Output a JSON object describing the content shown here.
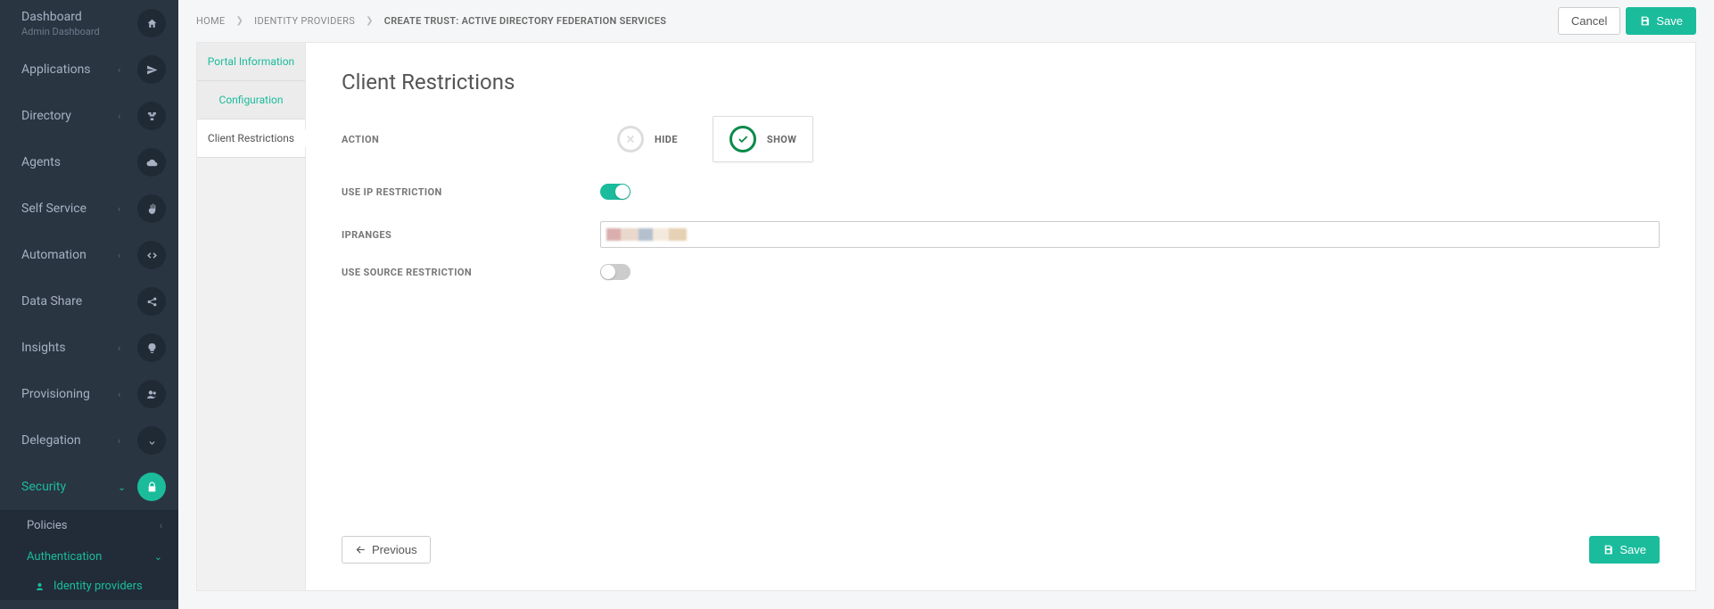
{
  "sidebar": {
    "items": [
      {
        "label": "Dashboard",
        "sub": "Admin Dashboard",
        "icon": "home",
        "chev": ""
      },
      {
        "label": "Applications",
        "icon": "send",
        "chev": "‹"
      },
      {
        "label": "Directory",
        "icon": "sitemap",
        "chev": "‹"
      },
      {
        "label": "Agents",
        "icon": "cloud",
        "chev": ""
      },
      {
        "label": "Self Service",
        "icon": "hand",
        "chev": "‹"
      },
      {
        "label": "Automation",
        "icon": "code",
        "chev": "‹"
      },
      {
        "label": "Data Share",
        "icon": "share",
        "chev": ""
      },
      {
        "label": "Insights",
        "icon": "bulb",
        "chev": "‹"
      },
      {
        "label": "Provisioning",
        "icon": "users",
        "chev": "‹"
      },
      {
        "label": "Delegation",
        "icon": "down",
        "chev": "‹"
      },
      {
        "label": "Security",
        "icon": "lock",
        "chev": "⌄",
        "active": true
      }
    ],
    "security_sub": {
      "policies": "Policies",
      "authentication": "Authentication",
      "identity_providers": "Identity providers"
    }
  },
  "breadcrumb": {
    "home": "HOME",
    "idp": "IDENTITY PROVIDERS",
    "current": "CREATE TRUST: ACTIVE DIRECTORY FEDERATION SERVICES"
  },
  "buttons": {
    "cancel": "Cancel",
    "save": "Save",
    "previous": "Previous"
  },
  "steps": {
    "portal": "Portal Information",
    "config": "Configuration",
    "client": "Client Restrictions"
  },
  "panel": {
    "title": "Client Restrictions",
    "action_label": "ACTION",
    "hide": "HIDE",
    "show": "SHOW",
    "use_ip": "USE IP RESTRICTION",
    "ipranges": "IPRANGES",
    "use_source": "USE SOURCE RESTRICTION"
  }
}
